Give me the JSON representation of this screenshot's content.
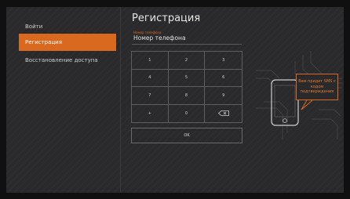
{
  "sidebar": {
    "items": [
      {
        "label": "Войти",
        "active": false
      },
      {
        "label": "Регистрация",
        "active": true
      },
      {
        "label": "Восстановление доступа",
        "active": false
      }
    ]
  },
  "main": {
    "title": "Регистрация",
    "phone": {
      "label": "Номер телефона",
      "value": "Номер телефона"
    },
    "keypad": [
      "1",
      "2",
      "3",
      "4",
      "5",
      "6",
      "7",
      "8",
      "9",
      "+",
      "0",
      "backspace-icon"
    ],
    "ok_label": "OK"
  },
  "illustration": {
    "bubble_text": "Вам придет SMS с кодом подтверждения"
  },
  "colors": {
    "accent": "#d9691f",
    "panel": "#2a2a2c",
    "background": "#101011"
  }
}
